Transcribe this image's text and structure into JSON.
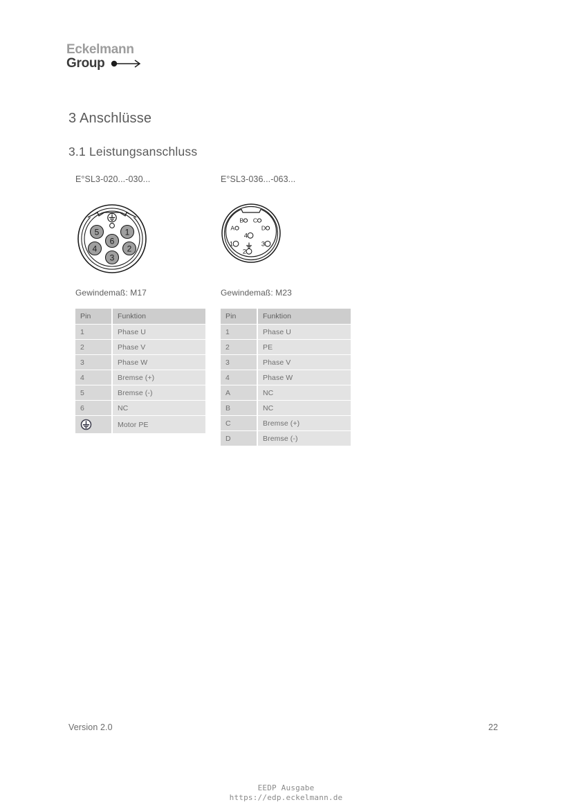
{
  "logo": {
    "line1": "Eckelmann",
    "line2": "Group",
    "arrow_icon": "arrow-right-icon"
  },
  "headings": {
    "h1": "3 Anschlüsse",
    "h2": "3.1 Leistungsanschluss"
  },
  "connectors": [
    {
      "model": "E°SL3-020...-030...",
      "diagram": "m17-connector-diagram",
      "thread": "Gewindemaß: M17",
      "pins_visual": [
        "1",
        "2",
        "3",
        "4",
        "5",
        "6"
      ],
      "ground_symbol": "pe-earth-icon",
      "table": {
        "columns": [
          "Pin",
          "Funktion"
        ],
        "rows": [
          {
            "pin": "1",
            "fn": "Phase U"
          },
          {
            "pin": "2",
            "fn": "Phase V"
          },
          {
            "pin": "3",
            "fn": "Phase W"
          },
          {
            "pin": "4",
            "fn": "Bremse (+)"
          },
          {
            "pin": "5",
            "fn": "Bremse (-)"
          },
          {
            "pin": "6",
            "fn": "NC"
          },
          {
            "pin": "",
            "pin_icon": "pe-earth-icon",
            "fn": "Motor PE"
          }
        ]
      }
    },
    {
      "model": "E°SL3-036...-063...",
      "diagram": "m23-connector-diagram",
      "thread": "Gewindemaß: M23",
      "pins_visual": [
        "A",
        "B",
        "C",
        "D",
        "1",
        "2",
        "3",
        "4"
      ],
      "ground_symbol": "pe-earth-icon",
      "table": {
        "columns": [
          "Pin",
          "Funktion"
        ],
        "rows": [
          {
            "pin": "1",
            "fn": "Phase U"
          },
          {
            "pin": "2",
            "fn": "PE"
          },
          {
            "pin": "3",
            "fn": "Phase V"
          },
          {
            "pin": "4",
            "fn": "Phase W"
          },
          {
            "pin": "A",
            "fn": "NC"
          },
          {
            "pin": "B",
            "fn": "NC"
          },
          {
            "pin": "C",
            "fn": "Bremse (+)"
          },
          {
            "pin": "D",
            "fn": "Bremse (-)"
          }
        ]
      }
    }
  ],
  "footer": {
    "version": "Version 2.0",
    "page": "22"
  },
  "watermark": {
    "line1": "EEDP Ausgabe",
    "line2": "https://edp.eckelmann.de"
  }
}
